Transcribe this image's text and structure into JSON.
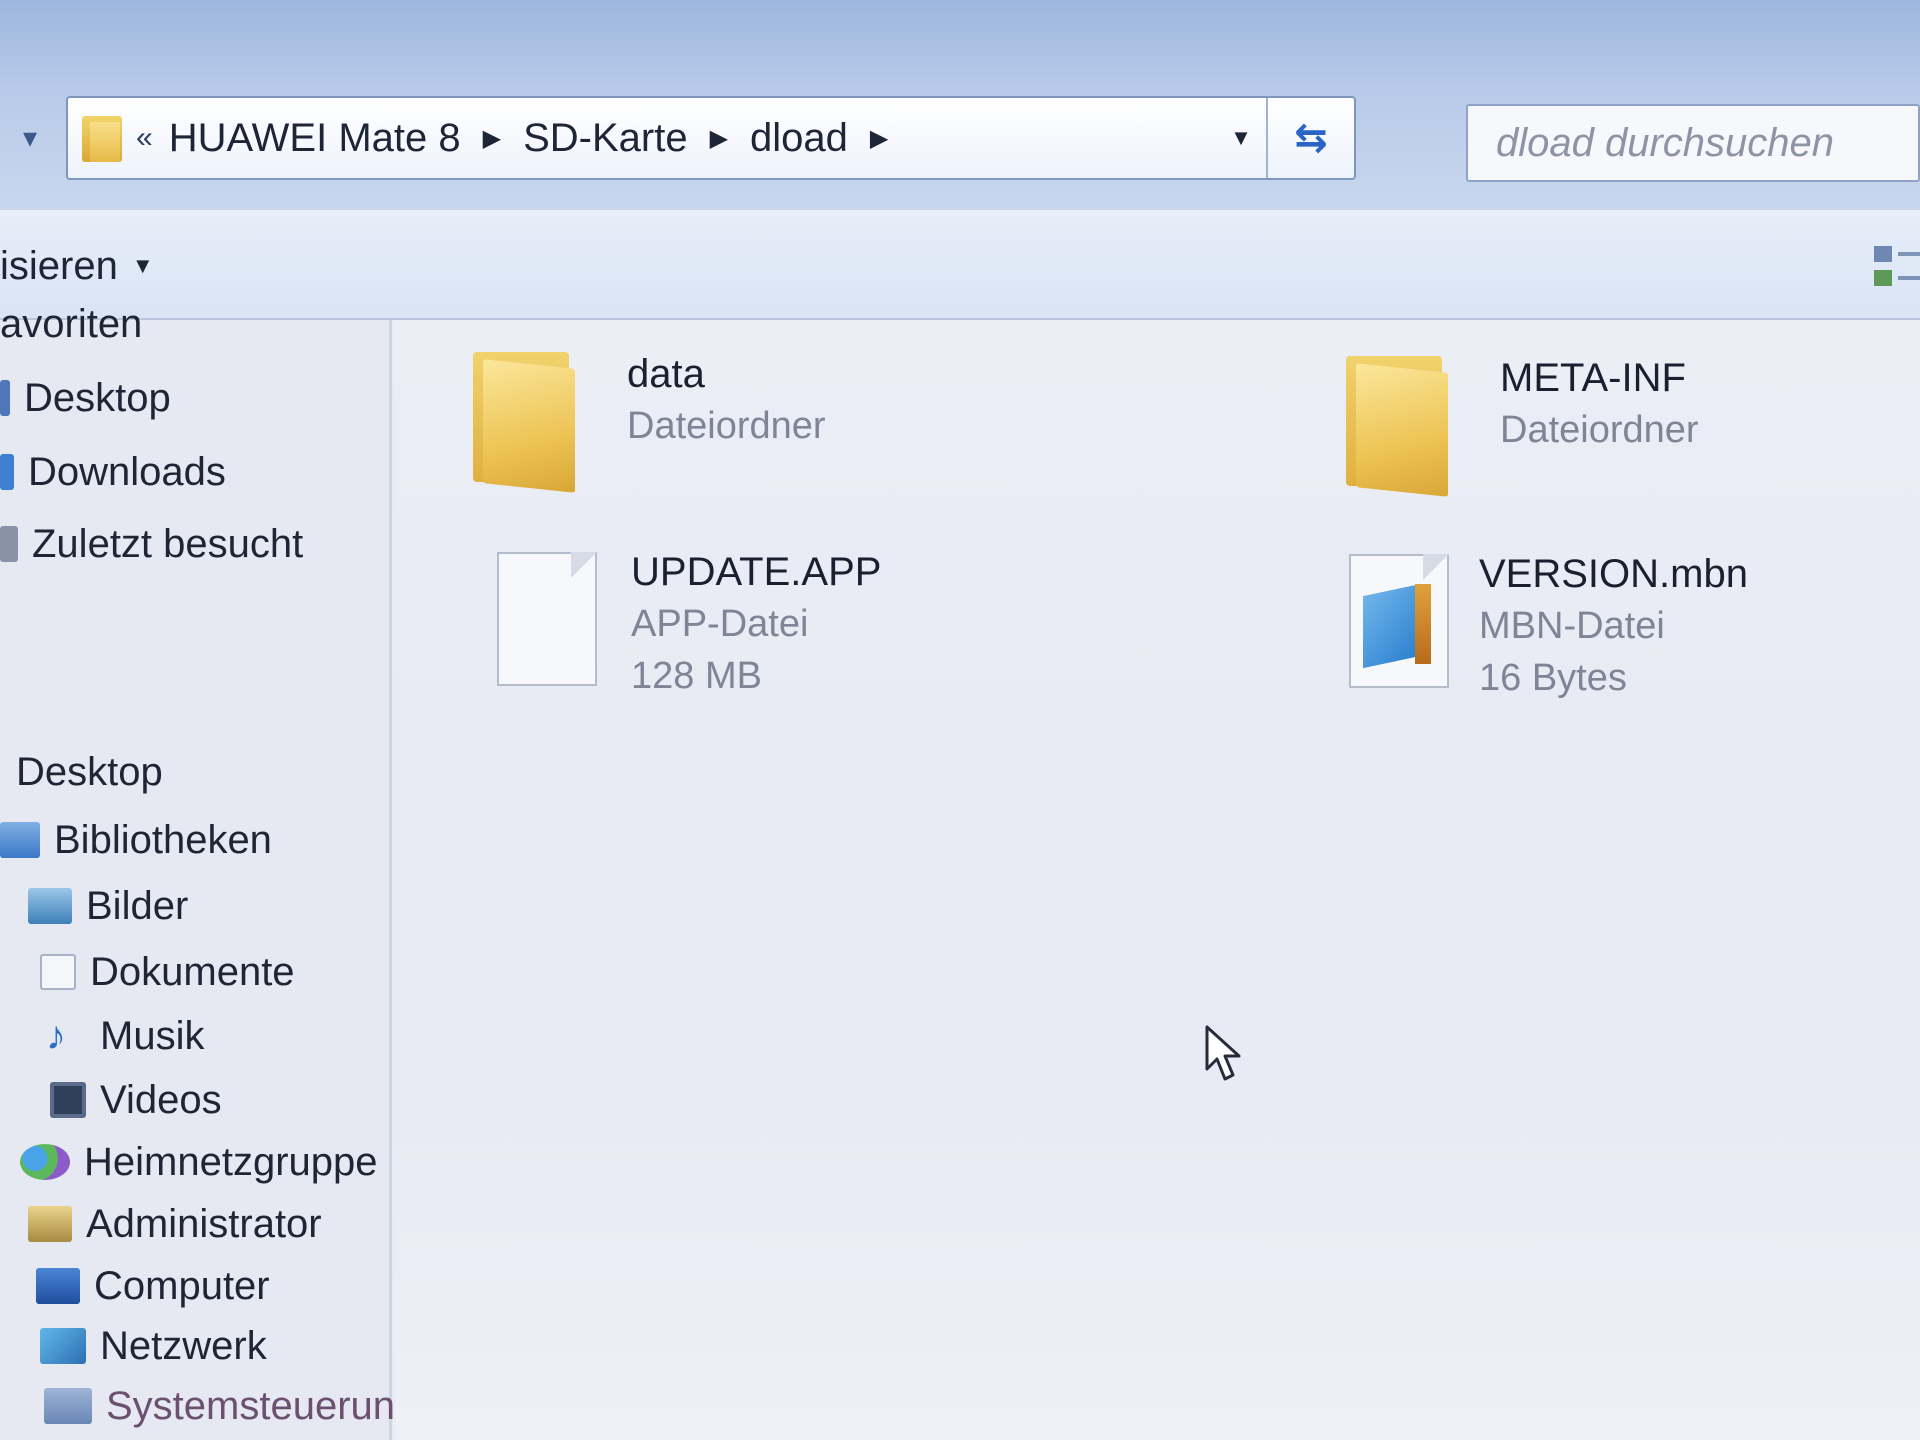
{
  "address_bar": {
    "overflow_chevron": "«",
    "breadcrumbs": [
      "HUAWEI Mate 8",
      "SD-Karte",
      "dload"
    ]
  },
  "search": {
    "placeholder": "dload durchsuchen"
  },
  "toolbar": {
    "organize_label": "isieren"
  },
  "sidebar": {
    "favorites_header": "avoriten",
    "favorites": [
      "Desktop",
      "Downloads",
      "Zuletzt besucht"
    ],
    "desktop_root": "Desktop",
    "tree": [
      "Bibliotheken",
      "Bilder",
      "Dokumente",
      "Musik",
      "Videos",
      "Heimnetzgruppe",
      "Administrator",
      "Computer",
      "Netzwerk",
      "Systemsteuerung"
    ]
  },
  "files": [
    {
      "name": "data",
      "type": "Dateiordner",
      "size": "",
      "icon": "folder-icon"
    },
    {
      "name": "META-INF",
      "type": "Dateiordner",
      "size": "",
      "icon": "folder-icon"
    },
    {
      "name": "UPDATE.APP",
      "type": "APP-Datei",
      "size": "128 MB",
      "icon": "blank-file-icon"
    },
    {
      "name": "VERSION.mbn",
      "type": "MBN-Datei",
      "size": "16 Bytes",
      "icon": "mbn-file-icon"
    }
  ],
  "colors": {
    "folder_yellow": "#edc455",
    "frame_blue": "#b9cbea",
    "link_blue": "#2a64c4"
  }
}
